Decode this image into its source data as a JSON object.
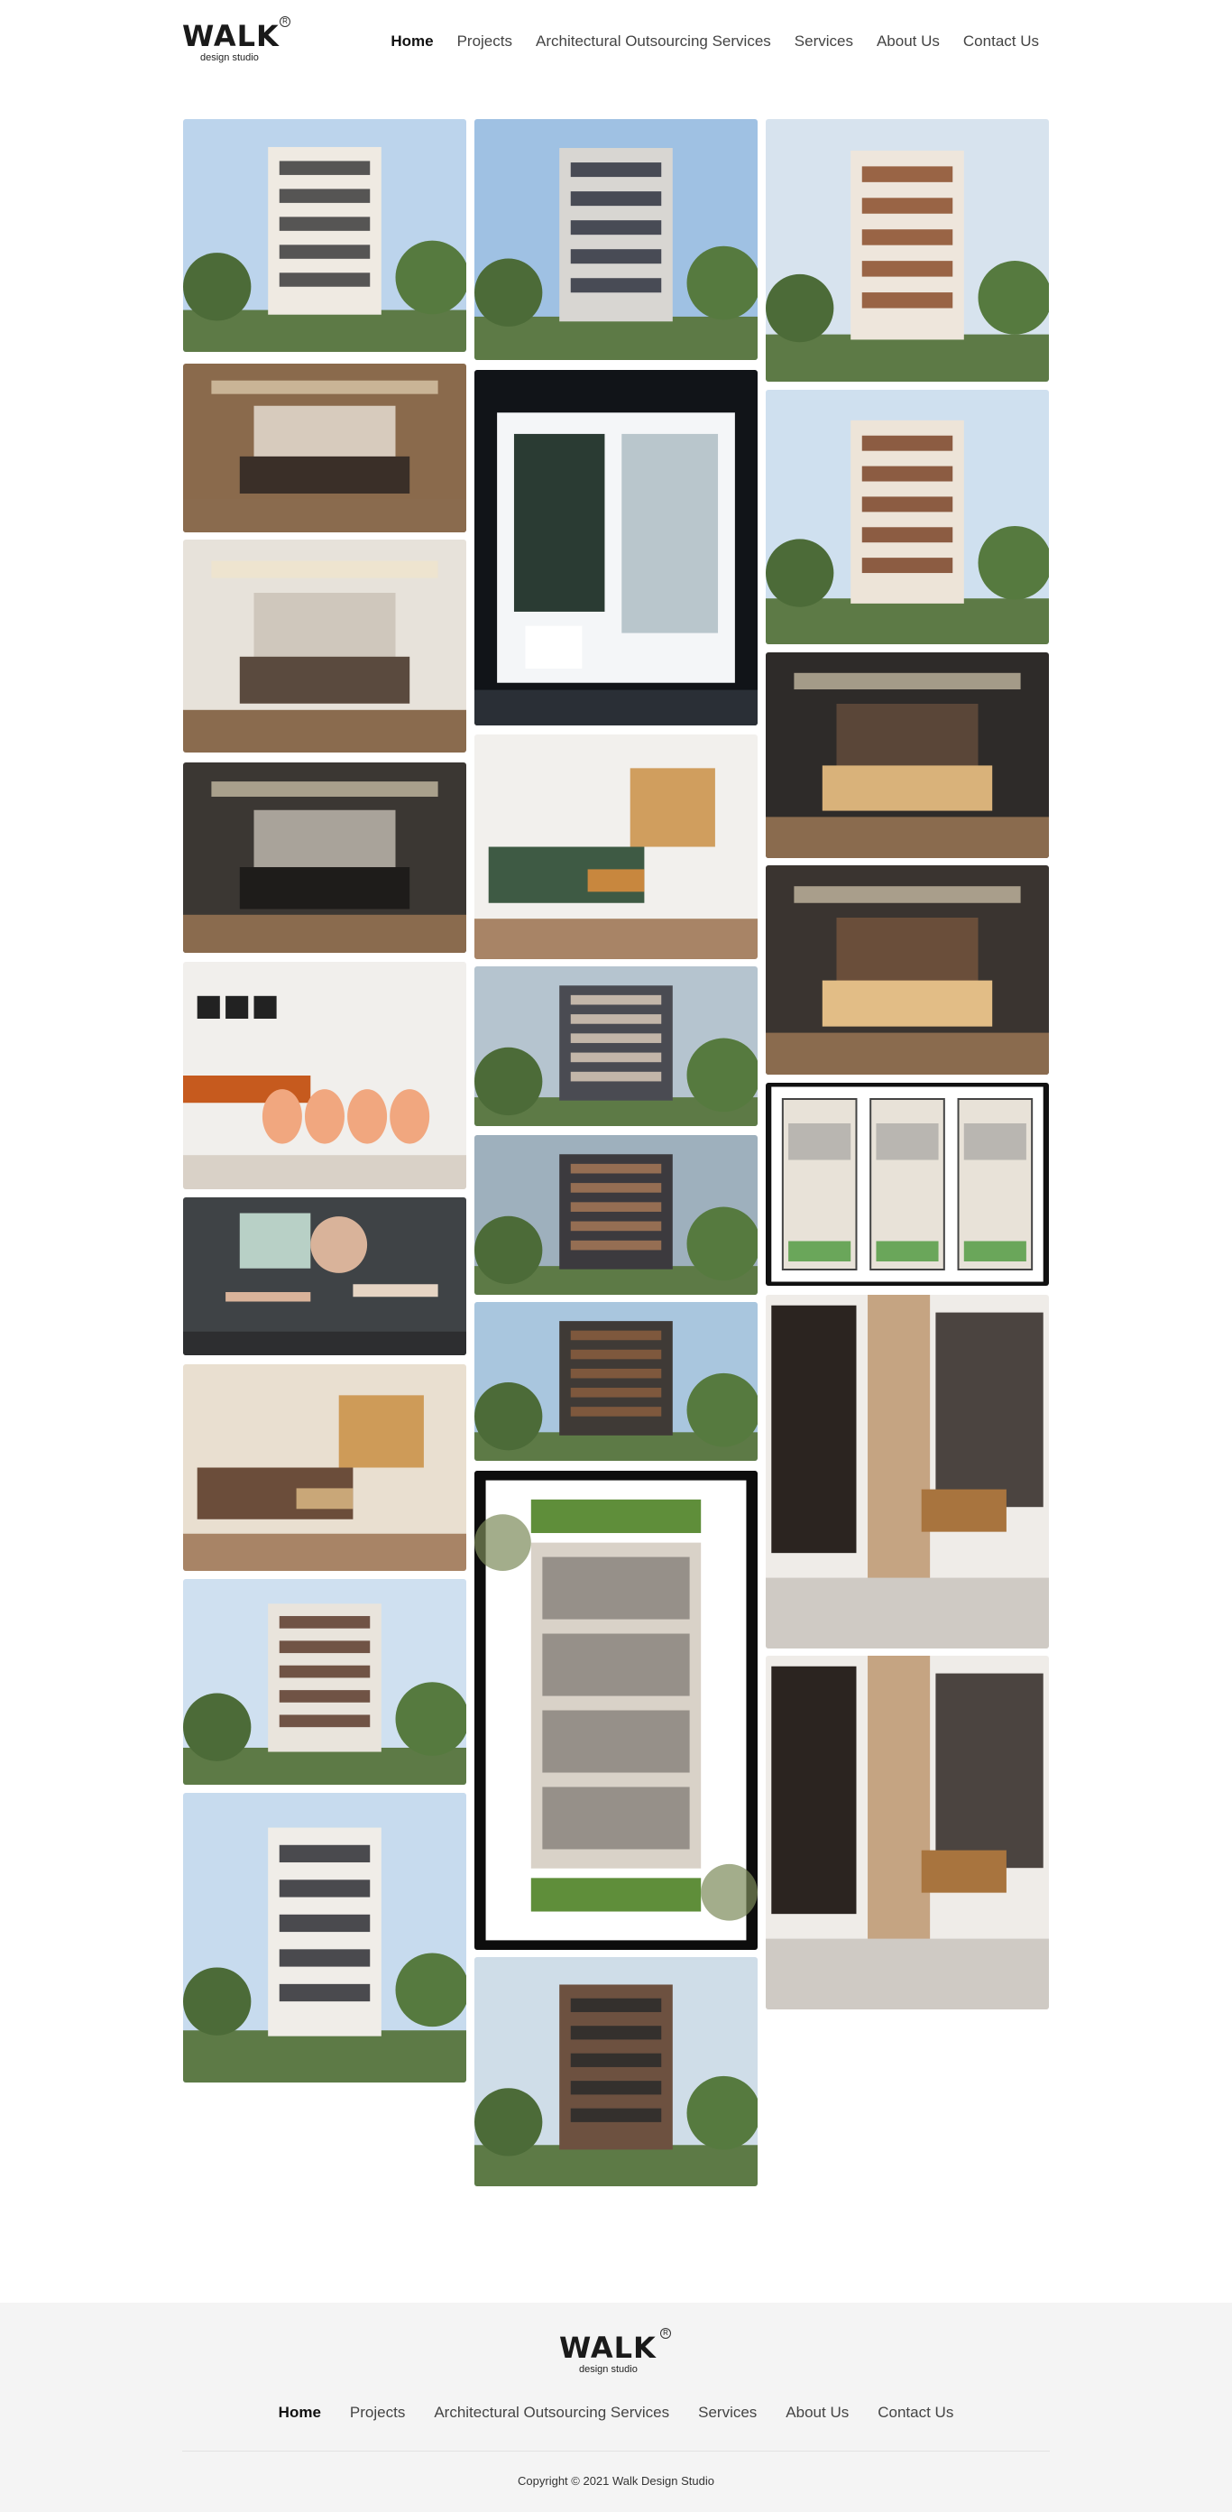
{
  "brand": {
    "logo_word": "WALK",
    "logo_sub": "design studio",
    "logo_reg": "R"
  },
  "nav": {
    "items": [
      {
        "label": "Home",
        "active": true
      },
      {
        "label": "Projects"
      },
      {
        "label": "Architectural Outsourcing Services"
      },
      {
        "label": "Services"
      },
      {
        "label": "About Us"
      },
      {
        "label": "Contact Us"
      }
    ]
  },
  "gallery": {
    "columns": [
      [
        {
          "name": "tile-exterior-tower-1",
          "kind": "exterior",
          "sky": "#bcd4ec",
          "main": "#efeae2",
          "accent": "#3b3b3b"
        },
        {
          "name": "tile-bedroom-1",
          "kind": "bedroom",
          "sky": "#8a6a4c",
          "main": "#d7cbbd",
          "accent": "#3a2f28"
        },
        {
          "name": "tile-bedroom-2",
          "kind": "bedroom",
          "sky": "#e7e2da",
          "main": "#cfc7bc",
          "accent": "#5a4a3e"
        },
        {
          "name": "tile-bedroom-3",
          "kind": "bedroom",
          "sky": "#3b3733",
          "main": "#a9a39a",
          "accent": "#1e1c1a"
        },
        {
          "name": "tile-dining-1",
          "kind": "dining",
          "sky": "#f1efec",
          "main": "#f1a77f",
          "accent": "#c65a1e"
        },
        {
          "name": "tile-study-1",
          "kind": "study",
          "sky": "#3f4346",
          "main": "#d9b39a",
          "accent": "#e6d5c4"
        },
        {
          "name": "tile-living-1",
          "kind": "living",
          "sky": "#e9dfd0",
          "main": "#6b4d3a",
          "accent": "#c9a778"
        },
        {
          "name": "tile-exterior-villa-1",
          "kind": "exterior",
          "sky": "#cfe0f0",
          "main": "#e9e4dc",
          "accent": "#5a3a2a"
        },
        {
          "name": "tile-exterior-villa-2",
          "kind": "exterior",
          "sky": "#c7dbee",
          "main": "#f0ede8",
          "accent": "#2d2d33"
        }
      ],
      [
        {
          "name": "tile-exterior-tower-2",
          "kind": "exterior",
          "sky": "#9fc1e3",
          "main": "#d8d6d2",
          "accent": "#2f3240"
        },
        {
          "name": "tile-bathroom-1",
          "kind": "bathroom",
          "sky": "#111418",
          "main": "#f4f6f8",
          "accent": "#2a3b33"
        },
        {
          "name": "tile-living-2",
          "kind": "living",
          "sky": "#f2f0ed",
          "main": "#3e5a44",
          "accent": "#c8873e"
        },
        {
          "name": "tile-exterior-villa-3",
          "kind": "exterior",
          "sky": "#b5c4cf",
          "main": "#4a4b52",
          "accent": "#d8c9b8"
        },
        {
          "name": "tile-exterior-villa-4",
          "kind": "exterior",
          "sky": "#9eb0bd",
          "main": "#3c3a3e",
          "accent": "#a57857"
        },
        {
          "name": "tile-exterior-villa-5",
          "kind": "exterior",
          "sky": "#a9c6de",
          "main": "#3f3a36",
          "accent": "#8a5e3e"
        },
        {
          "name": "tile-floor-plan-1",
          "kind": "plan",
          "sky": "#ffffff",
          "main": "#5f5a55",
          "accent": "#5f8e3a"
        },
        {
          "name": "tile-exterior-villa-6",
          "kind": "exterior",
          "sky": "#cfdde8",
          "main": "#6d5140",
          "accent": "#2a2a2a"
        }
      ],
      [
        {
          "name": "tile-exterior-tower-3",
          "kind": "exterior",
          "sky": "#d7e3ee",
          "main": "#eee6dc",
          "accent": "#8a4c2a"
        },
        {
          "name": "tile-exterior-tower-4",
          "kind": "exterior",
          "sky": "#cfe0ef",
          "main": "#ede4d8",
          "accent": "#7a4428"
        },
        {
          "name": "tile-bedroom-4",
          "kind": "bedroom",
          "sky": "#2e2b29",
          "main": "#5a4638",
          "accent": "#d9b27a"
        },
        {
          "name": "tile-bedroom-5",
          "kind": "bedroom",
          "sky": "#3a3430",
          "main": "#6a4e3a",
          "accent": "#e2bd86"
        },
        {
          "name": "tile-floor-plan-2",
          "kind": "plan2",
          "sky": "#ffffff",
          "main": "#8a8a8a",
          "accent": "#6aa65a"
        },
        {
          "name": "tile-bathroom-2",
          "kind": "bathroom2",
          "sky": "#efece8",
          "main": "#a8743e",
          "accent": "#2b2420"
        },
        {
          "name": "tile-bathroom-3",
          "kind": "bathroom2",
          "sky": "#efece8",
          "main": "#a8743e",
          "accent": "#2b2420"
        }
      ]
    ]
  },
  "footer": {
    "logo_word": "WALK",
    "logo_sub": "design studio",
    "logo_reg": "R",
    "nav": [
      {
        "label": "Home",
        "active": true
      },
      {
        "label": "Projects"
      },
      {
        "label": "Architectural Outsourcing Services"
      },
      {
        "label": "Services"
      },
      {
        "label": "About Us"
      },
      {
        "label": "Contact Us"
      }
    ],
    "copyright": "Copyright © 2021 Walk Design Studio"
  }
}
